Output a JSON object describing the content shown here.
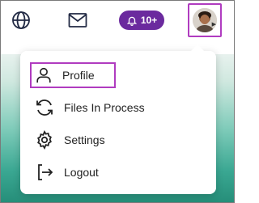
{
  "topbar": {
    "icons": {
      "globe": "globe-icon",
      "mail": "mail-icon",
      "bell": "bell-icon"
    },
    "notifications": {
      "count": "10+",
      "color": "#6b2a9e"
    },
    "avatar": {
      "highlight_color": "#b03cc0"
    }
  },
  "menu": {
    "items": [
      {
        "label": "Profile",
        "icon": "user-icon"
      },
      {
        "label": "Files In Process",
        "icon": "sync-icon"
      },
      {
        "label": "Settings",
        "icon": "gear-icon"
      },
      {
        "label": "Logout",
        "icon": "logout-icon"
      }
    ]
  }
}
